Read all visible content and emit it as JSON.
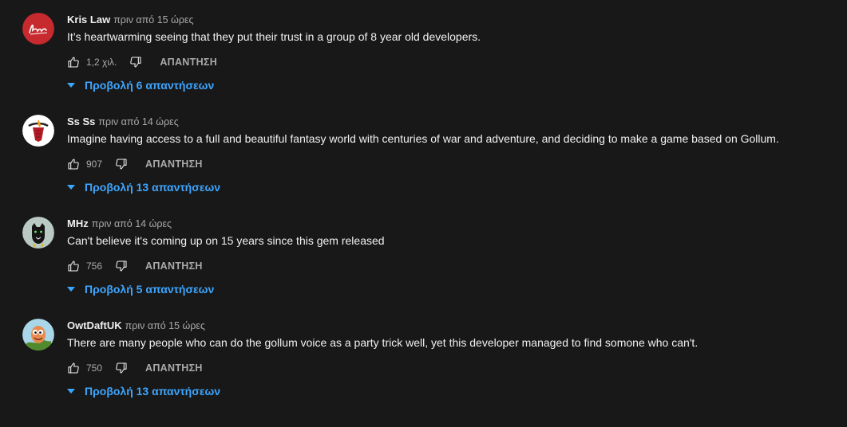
{
  "comments": [
    {
      "author": "Kris Law",
      "time": "πριν από 15 ώρες",
      "text": "It’s heartwarming seeing that they put their trust in a group of 8 year old developers.",
      "likes": "1,2 χιλ.",
      "reply_label": "ΑΠΑΝΤΗΣΗ",
      "view_replies": "Προβολή 6 απαντήσεων",
      "avatar_icon": "signature-logo-avatar"
    },
    {
      "author": "Ss Ss",
      "time": "πριν από 14 ώρες",
      "text": "Imagine having access to a full and beautiful fantasy world with centuries of war and adventure, and deciding to make a game based on Gollum.",
      "likes": "907",
      "reply_label": "ΑΠΑΝΤΗΣΗ",
      "view_replies": "Προβολή 13 απαντήσεων",
      "avatar_icon": "heat-logo-avatar"
    },
    {
      "author": "MHz",
      "time": "πριν από 14 ώρες",
      "text": "Can't believe it's coming up on 15 years since this gem released",
      "likes": "756",
      "reply_label": "ΑΠΑΝΤΗΣΗ",
      "view_replies": "Προβολή 5 απαντήσεων",
      "avatar_icon": "panther-avatar"
    },
    {
      "author": "OwtDaftUK",
      "time": "πριν από 15 ώρες",
      "text": "There are many people who can do the gollum voice as a party trick well, yet this developer managed to find somone who can't.",
      "likes": "750",
      "reply_label": "ΑΠΑΝΤΗΣΗ",
      "view_replies": "Προβολή 13 απαντήσεων",
      "avatar_icon": "worm-cartoon-avatar"
    }
  ],
  "colors": {
    "background": "#181818",
    "text": "#f1f1f1",
    "secondary": "#aaaaaa",
    "link": "#3ea6ff"
  }
}
